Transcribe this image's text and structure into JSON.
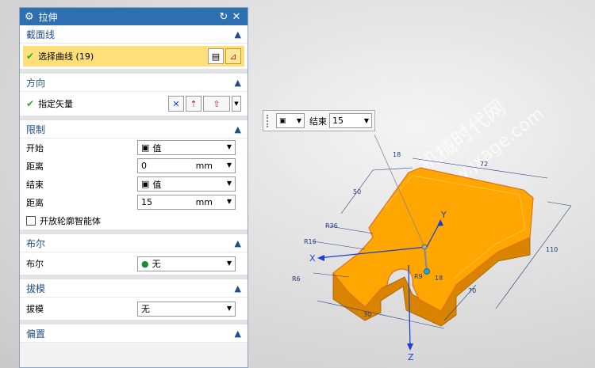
{
  "dialog": {
    "title": "拉伸",
    "groups": {
      "section": {
        "header": "截面线",
        "select_curve": "选择曲线 (19)"
      },
      "direction": {
        "header": "方向",
        "vector": "指定矢量"
      },
      "limits": {
        "header": "限制",
        "start_label": "开始",
        "start_value": "值",
        "start_dist_label": "距离",
        "start_dist_value": "0",
        "start_unit": "mm",
        "end_label": "结束",
        "end_value": "值",
        "end_dist_label": "距离",
        "end_dist_value": "15",
        "end_unit": "mm",
        "open_profile": "开放轮廓智能体"
      },
      "boolean": {
        "header": "布尔",
        "label": "布尔",
        "value": "无"
      },
      "draft": {
        "header": "拔模",
        "label": "拔模",
        "value": "无"
      },
      "offset": {
        "header": "偏置"
      }
    }
  },
  "floatbar": {
    "end_label": "结束",
    "end_value": "15"
  },
  "viewport": {
    "axes": {
      "x": "X",
      "y": "Y",
      "z": "Z"
    },
    "dims": [
      "R36",
      "R16",
      "R6",
      "50",
      "72",
      "18",
      "110",
      "70",
      "30",
      "18",
      "R9"
    ],
    "watermark": [
      "机械时代网",
      "www.jxage.com"
    ]
  },
  "colors": {
    "part": "#ffa600",
    "part_dark": "#d98400",
    "title_bar": "#2d6fb0",
    "selection": "#ffdf7a"
  }
}
